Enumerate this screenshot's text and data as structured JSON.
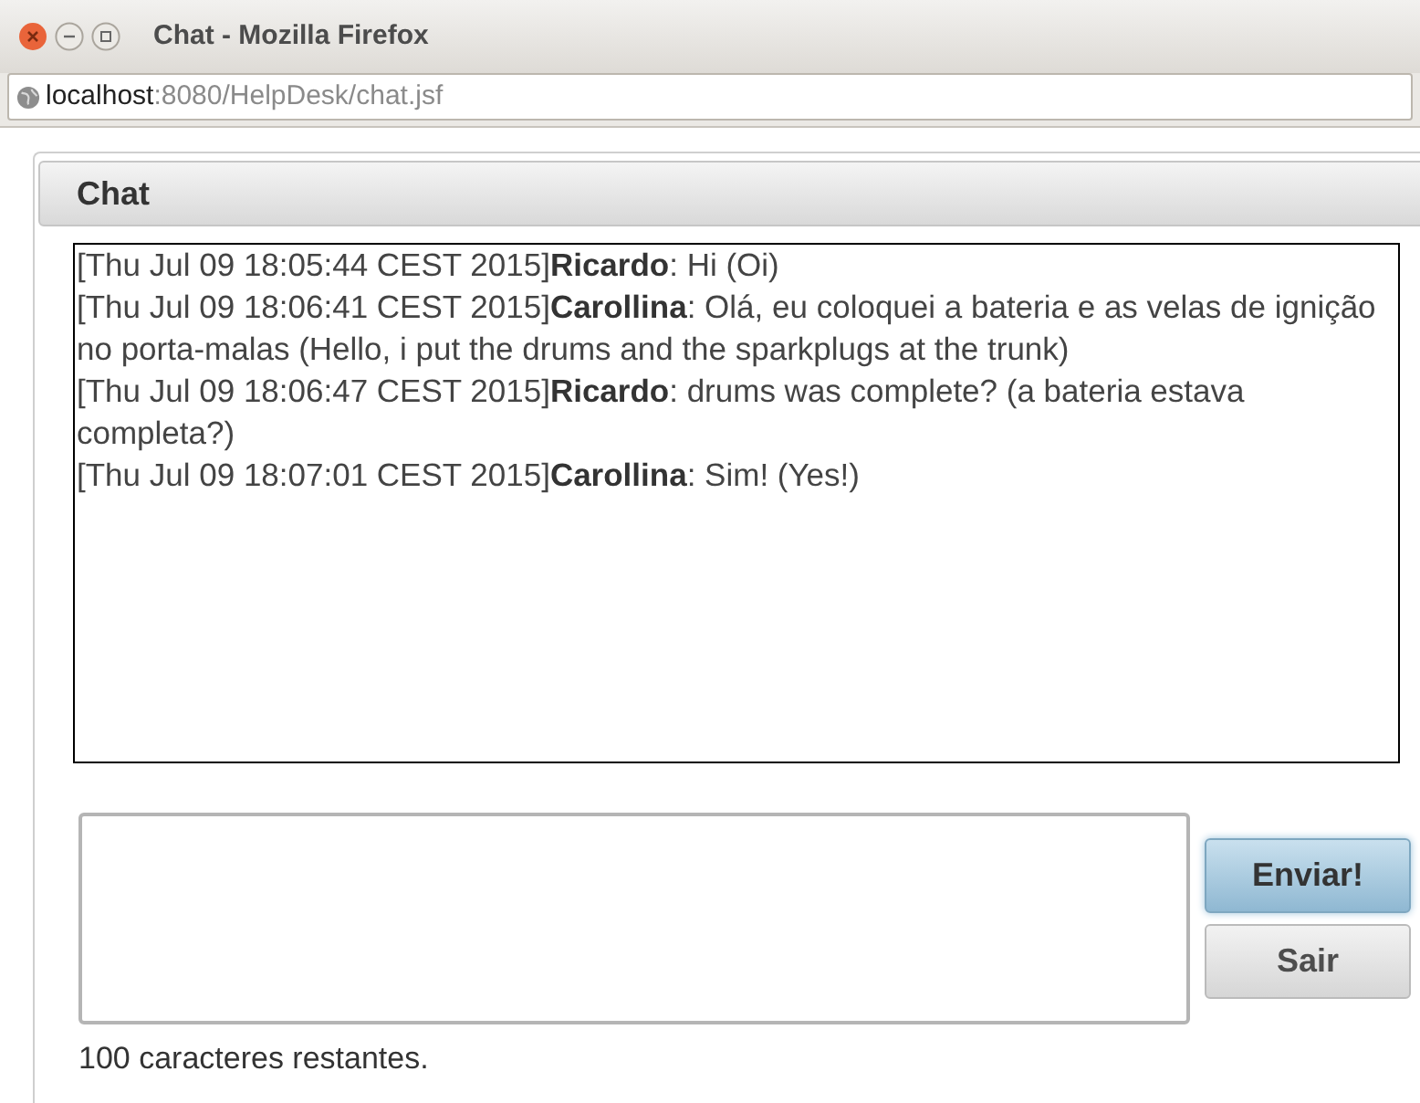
{
  "window": {
    "title": "Chat - Mozilla Firefox"
  },
  "address_bar": {
    "host": "localhost",
    "rest": ":8080/HelpDesk/chat.jsf"
  },
  "panel": {
    "title": "Chat"
  },
  "messages": [
    {
      "timestamp": "[Thu Jul 09 18:05:44 CEST 2015]",
      "sender": "Ricardo",
      "text": ": Hi (Oi)"
    },
    {
      "timestamp": "[Thu Jul 09 18:06:41 CEST 2015]",
      "sender": "Carollina",
      "text": ": Olá, eu coloquei a bateria e as velas de ignição no porta-malas (Hello, i put the drums and the sparkplugs at the trunk)"
    },
    {
      "timestamp": "[Thu Jul 09 18:06:47 CEST 2015]",
      "sender": "Ricardo",
      "text": ": drums was complete? (a bateria estava completa?)"
    },
    {
      "timestamp": "[Thu Jul 09 18:07:01 CEST 2015]",
      "sender": "Carollina",
      "text": ": Sim! (Yes!)"
    }
  ],
  "buttons": [
    {
      "label": "Enviar!",
      "highlighted": true
    },
    {
      "label": "Sair",
      "highlighted": false
    }
  ],
  "counter": "100 caracteres restantes."
}
